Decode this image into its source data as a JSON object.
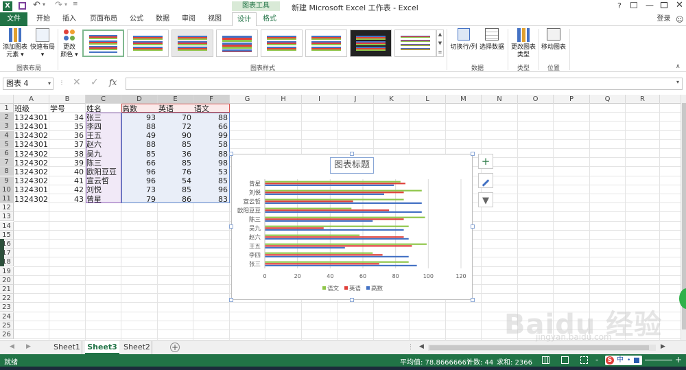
{
  "window": {
    "title": "新建 Microsoft Excel 工作表 - Excel",
    "context_tab": "图表工具",
    "help": "?",
    "login": "登录"
  },
  "ribbon_tabs": [
    "文件",
    "开始",
    "插入",
    "页面布局",
    "公式",
    "数据",
    "审阅",
    "视图",
    "设计",
    "格式"
  ],
  "ribbon": {
    "add_element": "添加图表元素",
    "quick_layout": "快速布局",
    "change_color": "更改颜色",
    "group_layout": "图表布局",
    "group_styles": "图表样式",
    "switch_rowcol": "切换行/列",
    "select_data": "选择数据",
    "group_data": "数据",
    "change_type": "更改图表类型",
    "group_type": "类型",
    "move_chart": "移动图表",
    "group_location": "位置"
  },
  "formula_bar": {
    "name_box": "图表 4",
    "fx": "fx",
    "value": ""
  },
  "columns": [
    "A",
    "B",
    "C",
    "D",
    "E",
    "F",
    "G",
    "H",
    "I",
    "J",
    "K",
    "L",
    "M",
    "N",
    "O",
    "P",
    "Q",
    "R"
  ],
  "rows": [
    "1",
    "2",
    "3",
    "4",
    "5",
    "6",
    "7",
    "8",
    "9",
    "10",
    "11",
    "12",
    "13",
    "14",
    "15",
    "16",
    "17",
    "18",
    "19",
    "20",
    "21",
    "22",
    "23",
    "24",
    "25",
    "26"
  ],
  "table": {
    "headers": [
      "班级",
      "学号",
      "姓名",
      "高数",
      "英语",
      "语文"
    ],
    "rows": [
      [
        "1324301",
        "34",
        "张三",
        "93",
        "70",
        "88"
      ],
      [
        "1324301",
        "35",
        "李四",
        "88",
        "72",
        "66"
      ],
      [
        "1324302",
        "36",
        "王五",
        "49",
        "90",
        "99"
      ],
      [
        "1324301",
        "37",
        "赵六",
        "88",
        "85",
        "58"
      ],
      [
        "1324302",
        "38",
        "吴九",
        "85",
        "36",
        "88"
      ],
      [
        "1324302",
        "39",
        "陈三",
        "66",
        "85",
        "98"
      ],
      [
        "1324302",
        "40",
        "欧阳豆豆",
        "96",
        "76",
        "53"
      ],
      [
        "1324302",
        "41",
        "宣云哲",
        "96",
        "54",
        "85"
      ],
      [
        "1324301",
        "42",
        "刘悦",
        "73",
        "85",
        "96"
      ],
      [
        "1324302",
        "43",
        "曾星",
        "79",
        "86",
        "83"
      ]
    ]
  },
  "chart_data": {
    "type": "bar",
    "orientation": "horizontal",
    "title": "图表标题",
    "categories": [
      "张三",
      "李四",
      "王五",
      "赵六",
      "吴九",
      "陈三",
      "欧阳豆豆",
      "宣云哲",
      "刘悦",
      "曾星"
    ],
    "series": [
      {
        "name": "高数",
        "color": "#4472c4",
        "values": [
          93,
          88,
          49,
          88,
          85,
          66,
          96,
          96,
          73,
          79
        ]
      },
      {
        "name": "英语",
        "color": "#e0403a",
        "values": [
          70,
          72,
          90,
          85,
          36,
          85,
          76,
          54,
          85,
          86
        ]
      },
      {
        "name": "语文",
        "color": "#8fc64a",
        "values": [
          88,
          66,
          99,
          58,
          88,
          98,
          53,
          85,
          96,
          83
        ]
      }
    ],
    "xlim": [
      0,
      120
    ],
    "xticks": [
      "0",
      "20",
      "40",
      "60",
      "80",
      "100",
      "120"
    ],
    "grid": true,
    "legend": "bottom",
    "legend_order": [
      "语文",
      "英语",
      "高数"
    ]
  },
  "chart_side_buttons": [
    "+",
    "brush-icon",
    "filter-icon"
  ],
  "sheets": [
    "Sheet1",
    "Sheet3",
    "Sheet2"
  ],
  "active_sheet": "Sheet3",
  "status": {
    "ready": "就绪",
    "avg": "平均值: 78.86666667",
    "count": "计数: 44",
    "sum": "求和: 2366",
    "zoom_minus": "-",
    "zoom_plus": "+"
  },
  "watermark": "Baidu 经验",
  "watermark_url": "jingyan.baidu.com",
  "ime": "中"
}
